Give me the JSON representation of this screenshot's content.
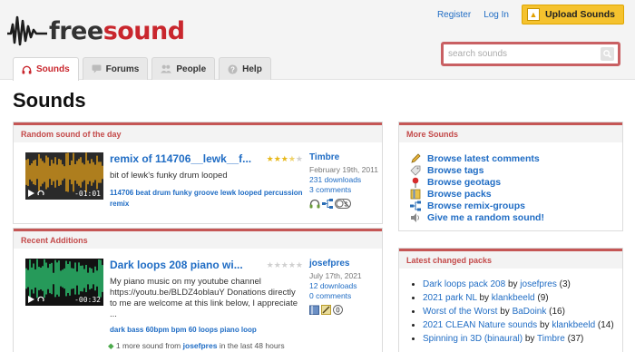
{
  "header": {
    "logo": {
      "free": "free",
      "sound": "sound"
    },
    "register": "Register",
    "login": "Log In",
    "upload": "Upload Sounds",
    "search_placeholder": "search sounds"
  },
  "tabs": [
    {
      "label": "Sounds",
      "icon": "headphones-icon",
      "active": true
    },
    {
      "label": "Forums",
      "icon": "speech-bubble-icon",
      "active": false
    },
    {
      "label": "People",
      "icon": "people-icon",
      "active": false
    },
    {
      "label": "Help",
      "icon": "question-icon",
      "active": false
    }
  ],
  "page_title": "Sounds",
  "random": {
    "heading": "Random sound of the day",
    "title": "remix of 114706__lewk__f...",
    "rating": 3.5,
    "description": "bit of lewk's funky drum looped",
    "tags": "114706 beat drum funky groove lewk looped percussion remix",
    "time": "-01:01",
    "user": "Timbre",
    "date": "February 19th, 2011",
    "downloads": "231 downloads",
    "comments": "3 comments",
    "wave_color": "#e8a21a"
  },
  "recent": {
    "heading": "Recent Additions",
    "title": "Dark loops 208 piano wi...",
    "rating": 0,
    "description": "My piano music on my youtube channel https://youtu.be/BLDZ4oblauY Donations directly to me are welcome at this link below, I appreciate ...",
    "tags": "dark bass 60bpm bpm 60 loops piano loop",
    "time": "-00:32",
    "user": "josefpres",
    "date": "July 17th, 2021",
    "downloads": "12 downloads",
    "comments": "0 comments",
    "more_text_a": "1 more sound from",
    "more_user": "josefpres",
    "more_text_b": "in the last 48 hours",
    "wave_color": "#2fd47a"
  },
  "more_sounds": {
    "heading": "More Sounds",
    "items": [
      {
        "label": "Browse latest comments",
        "icon": "pencil-icon"
      },
      {
        "label": "Browse tags",
        "icon": "tag-icon"
      },
      {
        "label": "Browse geotags",
        "icon": "map-pin-icon"
      },
      {
        "label": "Browse packs",
        "icon": "package-icon"
      },
      {
        "label": "Browse remix-groups",
        "icon": "remix-icon"
      },
      {
        "label": "Give me a random sound!",
        "icon": "speaker-icon"
      }
    ]
  },
  "packs": {
    "heading": "Latest changed packs",
    "items": [
      {
        "name": "Dark loops pack 208",
        "by": "by",
        "user": "josefpres",
        "count": "(3)"
      },
      {
        "name": "2021 park NL",
        "by": "by",
        "user": "klankbeeld",
        "count": "(9)"
      },
      {
        "name": "Worst of the Worst",
        "by": "by",
        "user": "BaDoink",
        "count": "(16)"
      },
      {
        "name": "2021 CLEAN Nature sounds",
        "by": "by",
        "user": "klankbeeld",
        "count": "(14)"
      },
      {
        "name": "Spinning in 3D (binaural)",
        "by": "by",
        "user": "Timbre",
        "count": "(37)"
      }
    ]
  },
  "colors": {
    "accent": "#c9262d",
    "link": "#1f6cc4",
    "upload": "#f5c22e"
  }
}
